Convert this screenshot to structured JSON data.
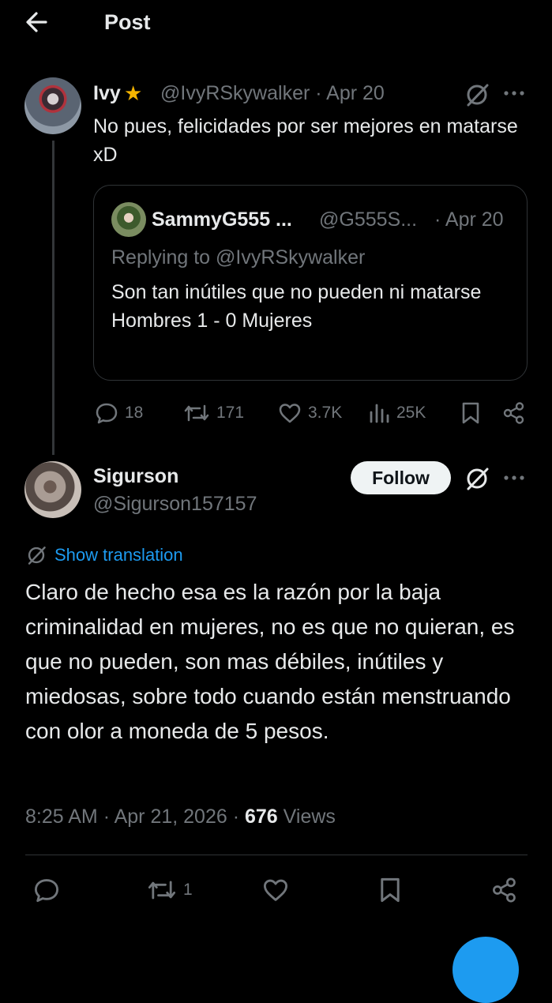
{
  "header": {
    "title": "Post"
  },
  "reply_post": {
    "name": "Ivy",
    "handle": "@IvyRSkywalker",
    "separator": "·",
    "date": "Apr 20",
    "text": "No pues, felicidades por ser mejores en matarse  xD",
    "quote": {
      "name": "SammyG555 ...",
      "handle": "@G555S...",
      "date": "· Apr 20",
      "replying_to": "Replying to @IvyRSkywalker",
      "text_line1": "Son tan inútiles que no pueden ni matarse",
      "text_line2": "Hombres 1 - 0 Mujeres"
    },
    "stats": {
      "replies": "18",
      "reposts": "171",
      "likes": "3.7K",
      "views": "25K"
    }
  },
  "main_post": {
    "name": "Sigurson",
    "handle": "@Sigurson157157",
    "follow_label": "Follow",
    "translate_label": "Show translation",
    "text": "Claro de hecho esa es la razón por la baja criminalidad en mujeres, no es que no quieran, es que no pueden, son mas débiles, inútiles y miedosas, sobre todo cuando están menstruando con olor a moneda de 5 pesos.",
    "time": "8:25 AM",
    "date": "Apr 21, 2026",
    "sep": "·",
    "views_count": "676",
    "views_label": "Views",
    "stats": {
      "reposts": "1"
    }
  },
  "colors": {
    "background": "#000000",
    "text": "#e7e9ea",
    "muted": "#71767b",
    "accent": "#1d9bf0",
    "star": "#f4b400"
  },
  "icons": [
    "back-arrow-icon",
    "grok-icon",
    "more-icon",
    "reply-icon",
    "repost-icon",
    "like-icon",
    "views-icon",
    "bookmark-icon",
    "share-icon",
    "translate-icon"
  ]
}
